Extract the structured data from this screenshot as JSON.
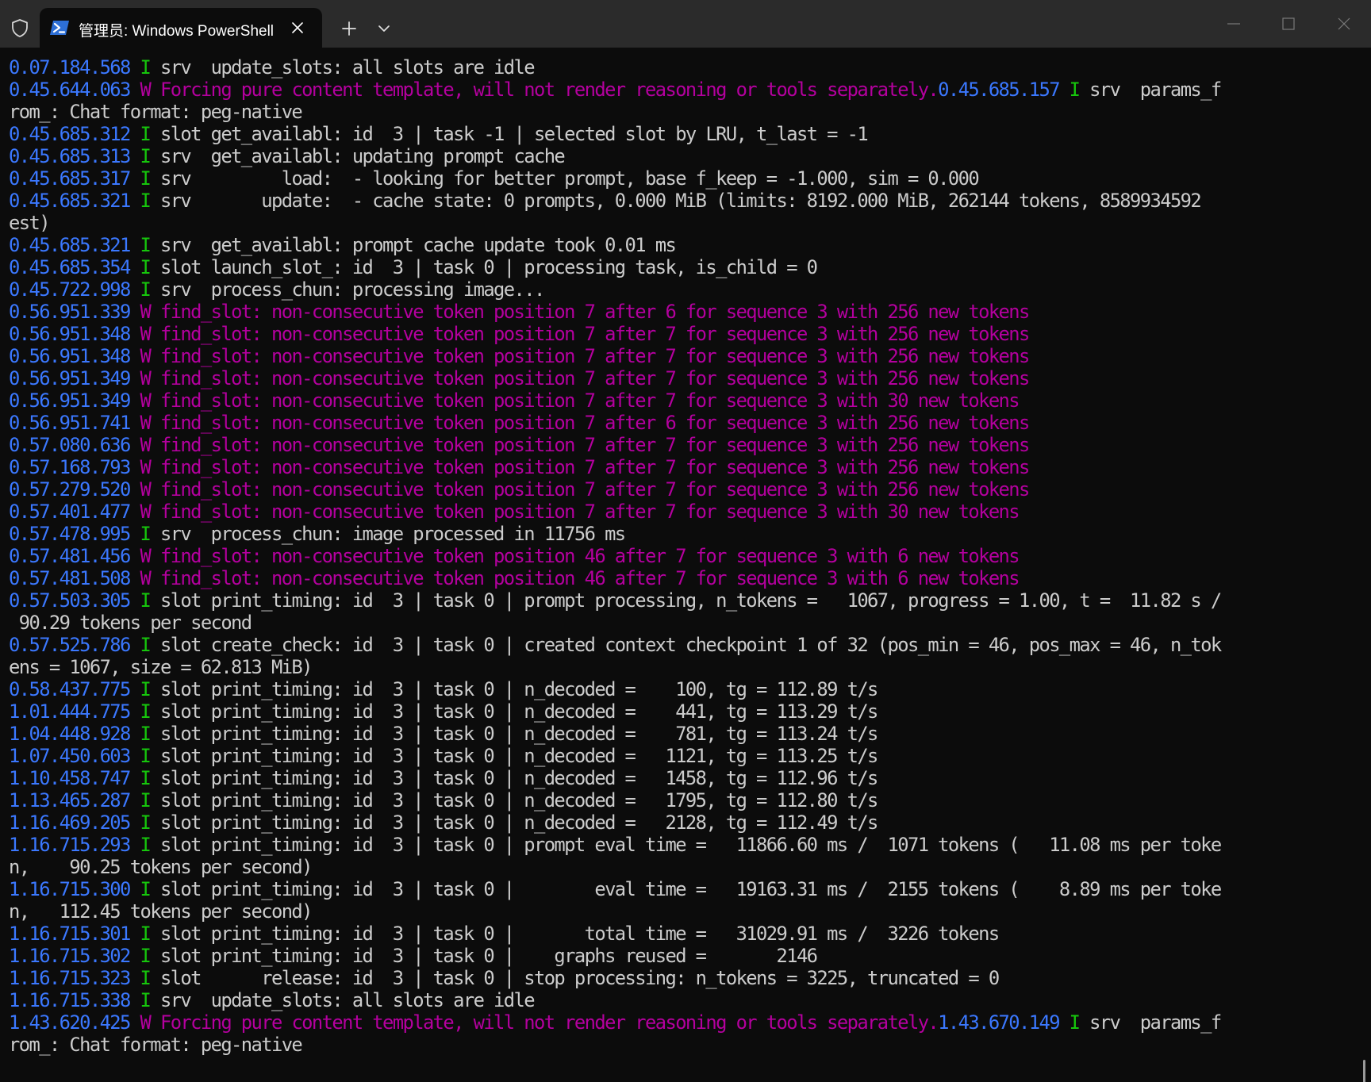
{
  "window": {
    "tab_title": "管理员: Windows PowerShell",
    "icons": {
      "shield": "shield-icon",
      "tab": "powershell-icon",
      "close_tab": "close-icon",
      "new_tab": "plus-icon",
      "dropdown": "chevron-down-icon",
      "minimize": "minimize-icon",
      "maximize": "maximize-icon",
      "close_window": "close-icon"
    }
  },
  "colors": {
    "background": "#0c0c0c",
    "titlebar": "#2b2b2b",
    "timestamp": "#3b78ff",
    "info_level": "#16c60c",
    "warning_level": "#b4009e",
    "text": "#cccccc"
  },
  "terminal": {
    "lines": [
      [
        [
          "ts",
          "0.07.184.568"
        ],
        [
          "t",
          " "
        ],
        [
          "li",
          "I"
        ],
        [
          "t",
          " srv  update_slots: all slots are idle"
        ]
      ],
      [
        [
          "ts",
          "0.45.644.063"
        ],
        [
          "t",
          " "
        ],
        [
          "lw",
          "W"
        ],
        [
          "wm",
          " Forcing pure content template, will not render reasoning or tools separately."
        ],
        [
          "ts",
          "0.45.685.157"
        ],
        [
          "t",
          " "
        ],
        [
          "li",
          "I"
        ],
        [
          "t",
          " srv  params_f"
        ]
      ],
      [
        [
          "t",
          "rom_: Chat format: peg-native"
        ]
      ],
      [
        [
          "ts",
          "0.45.685.312"
        ],
        [
          "t",
          " "
        ],
        [
          "li",
          "I"
        ],
        [
          "t",
          " slot get_availabl: id  3 | task -1 | selected slot by LRU, t_last = -1"
        ]
      ],
      [
        [
          "ts",
          "0.45.685.313"
        ],
        [
          "t",
          " "
        ],
        [
          "li",
          "I"
        ],
        [
          "t",
          " srv  get_availabl: updating prompt cache"
        ]
      ],
      [
        [
          "ts",
          "0.45.685.317"
        ],
        [
          "t",
          " "
        ],
        [
          "li",
          "I"
        ],
        [
          "t",
          " srv         load:  - looking for better prompt, base f_keep = -1.000, sim = 0.000"
        ]
      ],
      [
        [
          "ts",
          "0.45.685.321"
        ],
        [
          "t",
          " "
        ],
        [
          "li",
          "I"
        ],
        [
          "t",
          " srv       update:  - cache state: 0 prompts, 0.000 MiB (limits: 8192.000 MiB, 262144 tokens, 8589934592"
        ]
      ],
      [
        [
          "t",
          "est)"
        ]
      ],
      [
        [
          "ts",
          "0.45.685.321"
        ],
        [
          "t",
          " "
        ],
        [
          "li",
          "I"
        ],
        [
          "t",
          " srv  get_availabl: prompt cache update took 0.01 ms"
        ]
      ],
      [
        [
          "ts",
          "0.45.685.354"
        ],
        [
          "t",
          " "
        ],
        [
          "li",
          "I"
        ],
        [
          "t",
          " slot launch_slot_: id  3 | task 0 | processing task, is_child = 0"
        ]
      ],
      [
        [
          "ts",
          "0.45.722.998"
        ],
        [
          "t",
          " "
        ],
        [
          "li",
          "I"
        ],
        [
          "t",
          " srv  process_chun: processing image..."
        ]
      ],
      [
        [
          "ts",
          "0.56.951.339"
        ],
        [
          "t",
          " "
        ],
        [
          "lw",
          "W"
        ],
        [
          "wm",
          " find_slot: non-consecutive token position 7 after 6 for sequence 3 with 256 new tokens"
        ]
      ],
      [
        [
          "ts",
          "0.56.951.348"
        ],
        [
          "t",
          " "
        ],
        [
          "lw",
          "W"
        ],
        [
          "wm",
          " find_slot: non-consecutive token position 7 after 7 for sequence 3 with 256 new tokens"
        ]
      ],
      [
        [
          "ts",
          "0.56.951.348"
        ],
        [
          "t",
          " "
        ],
        [
          "lw",
          "W"
        ],
        [
          "wm",
          " find_slot: non-consecutive token position 7 after 7 for sequence 3 with 256 new tokens"
        ]
      ],
      [
        [
          "ts",
          "0.56.951.349"
        ],
        [
          "t",
          " "
        ],
        [
          "lw",
          "W"
        ],
        [
          "wm",
          " find_slot: non-consecutive token position 7 after 7 for sequence 3 with 256 new tokens"
        ]
      ],
      [
        [
          "ts",
          "0.56.951.349"
        ],
        [
          "t",
          " "
        ],
        [
          "lw",
          "W"
        ],
        [
          "wm",
          " find_slot: non-consecutive token position 7 after 7 for sequence 3 with 30 new tokens"
        ]
      ],
      [
        [
          "ts",
          "0.56.951.741"
        ],
        [
          "t",
          " "
        ],
        [
          "lw",
          "W"
        ],
        [
          "wm",
          " find_slot: non-consecutive token position 7 after 6 for sequence 3 with 256 new tokens"
        ]
      ],
      [
        [
          "ts",
          "0.57.080.636"
        ],
        [
          "t",
          " "
        ],
        [
          "lw",
          "W"
        ],
        [
          "wm",
          " find_slot: non-consecutive token position 7 after 7 for sequence 3 with 256 new tokens"
        ]
      ],
      [
        [
          "ts",
          "0.57.168.793"
        ],
        [
          "t",
          " "
        ],
        [
          "lw",
          "W"
        ],
        [
          "wm",
          " find_slot: non-consecutive token position 7 after 7 for sequence 3 with 256 new tokens"
        ]
      ],
      [
        [
          "ts",
          "0.57.279.520"
        ],
        [
          "t",
          " "
        ],
        [
          "lw",
          "W"
        ],
        [
          "wm",
          " find_slot: non-consecutive token position 7 after 7 for sequence 3 with 256 new tokens"
        ]
      ],
      [
        [
          "ts",
          "0.57.401.477"
        ],
        [
          "t",
          " "
        ],
        [
          "lw",
          "W"
        ],
        [
          "wm",
          " find_slot: non-consecutive token position 7 after 7 for sequence 3 with 30 new tokens"
        ]
      ],
      [
        [
          "ts",
          "0.57.478.995"
        ],
        [
          "t",
          " "
        ],
        [
          "li",
          "I"
        ],
        [
          "t",
          " srv  process_chun: image processed in 11756 ms"
        ]
      ],
      [
        [
          "ts",
          "0.57.481.456"
        ],
        [
          "t",
          " "
        ],
        [
          "lw",
          "W"
        ],
        [
          "wm",
          " find_slot: non-consecutive token position 46 after 7 for sequence 3 with 6 new tokens"
        ]
      ],
      [
        [
          "ts",
          "0.57.481.508"
        ],
        [
          "t",
          " "
        ],
        [
          "lw",
          "W"
        ],
        [
          "wm",
          " find_slot: non-consecutive token position 46 after 7 for sequence 3 with 6 new tokens"
        ]
      ],
      [
        [
          "ts",
          "0.57.503.305"
        ],
        [
          "t",
          " "
        ],
        [
          "li",
          "I"
        ],
        [
          "t",
          " slot print_timing: id  3 | task 0 | prompt processing, n_tokens =   1067, progress = 1.00, t =  11.82 s /"
        ]
      ],
      [
        [
          "t",
          " 90.29 tokens per second"
        ]
      ],
      [
        [
          "ts",
          "0.57.525.786"
        ],
        [
          "t",
          " "
        ],
        [
          "li",
          "I"
        ],
        [
          "t",
          " slot create_check: id  3 | task 0 | created context checkpoint 1 of 32 (pos_min = 46, pos_max = 46, n_tok"
        ]
      ],
      [
        [
          "t",
          "ens = 1067, size = 62.813 MiB)"
        ]
      ],
      [
        [
          "ts",
          "0.58.437.775"
        ],
        [
          "t",
          " "
        ],
        [
          "li",
          "I"
        ],
        [
          "t",
          " slot print_timing: id  3 | task 0 | n_decoded =    100, tg = 112.89 t/s"
        ]
      ],
      [
        [
          "ts",
          "1.01.444.775"
        ],
        [
          "t",
          " "
        ],
        [
          "li",
          "I"
        ],
        [
          "t",
          " slot print_timing: id  3 | task 0 | n_decoded =    441, tg = 113.29 t/s"
        ]
      ],
      [
        [
          "ts",
          "1.04.448.928"
        ],
        [
          "t",
          " "
        ],
        [
          "li",
          "I"
        ],
        [
          "t",
          " slot print_timing: id  3 | task 0 | n_decoded =    781, tg = 113.24 t/s"
        ]
      ],
      [
        [
          "ts",
          "1.07.450.603"
        ],
        [
          "t",
          " "
        ],
        [
          "li",
          "I"
        ],
        [
          "t",
          " slot print_timing: id  3 | task 0 | n_decoded =   1121, tg = 113.25 t/s"
        ]
      ],
      [
        [
          "ts",
          "1.10.458.747"
        ],
        [
          "t",
          " "
        ],
        [
          "li",
          "I"
        ],
        [
          "t",
          " slot print_timing: id  3 | task 0 | n_decoded =   1458, tg = 112.96 t/s"
        ]
      ],
      [
        [
          "ts",
          "1.13.465.287"
        ],
        [
          "t",
          " "
        ],
        [
          "li",
          "I"
        ],
        [
          "t",
          " slot print_timing: id  3 | task 0 | n_decoded =   1795, tg = 112.80 t/s"
        ]
      ],
      [
        [
          "ts",
          "1.16.469.205"
        ],
        [
          "t",
          " "
        ],
        [
          "li",
          "I"
        ],
        [
          "t",
          " slot print_timing: id  3 | task 0 | n_decoded =   2128, tg = 112.49 t/s"
        ]
      ],
      [
        [
          "ts",
          "1.16.715.293"
        ],
        [
          "t",
          " "
        ],
        [
          "li",
          "I"
        ],
        [
          "t",
          " slot print_timing: id  3 | task 0 | prompt eval time =   11866.60 ms /  1071 tokens (   11.08 ms per toke"
        ]
      ],
      [
        [
          "t",
          "n,    90.25 tokens per second)"
        ]
      ],
      [
        [
          "ts",
          "1.16.715.300"
        ],
        [
          "t",
          " "
        ],
        [
          "li",
          "I"
        ],
        [
          "t",
          " slot print_timing: id  3 | task 0 |        eval time =   19163.31 ms /  2155 tokens (    8.89 ms per toke"
        ]
      ],
      [
        [
          "t",
          "n,   112.45 tokens per second)"
        ]
      ],
      [
        [
          "ts",
          "1.16.715.301"
        ],
        [
          "t",
          " "
        ],
        [
          "li",
          "I"
        ],
        [
          "t",
          " slot print_timing: id  3 | task 0 |       total time =   31029.91 ms /  3226 tokens"
        ]
      ],
      [
        [
          "ts",
          "1.16.715.302"
        ],
        [
          "t",
          " "
        ],
        [
          "li",
          "I"
        ],
        [
          "t",
          " slot print_timing: id  3 | task 0 |    graphs reused =       2146"
        ]
      ],
      [
        [
          "ts",
          "1.16.715.323"
        ],
        [
          "t",
          " "
        ],
        [
          "li",
          "I"
        ],
        [
          "t",
          " slot      release: id  3 | task 0 | stop processing: n_tokens = 3225, truncated = 0"
        ]
      ],
      [
        [
          "ts",
          "1.16.715.338"
        ],
        [
          "t",
          " "
        ],
        [
          "li",
          "I"
        ],
        [
          "t",
          " srv  update_slots: all slots are idle"
        ]
      ],
      [
        [
          "ts",
          "1.43.620.425"
        ],
        [
          "t",
          " "
        ],
        [
          "lw",
          "W"
        ],
        [
          "wm",
          " Forcing pure content template, will not render reasoning or tools separately."
        ],
        [
          "ts",
          "1.43.670.149"
        ],
        [
          "t",
          " "
        ],
        [
          "li",
          "I"
        ],
        [
          "t",
          " srv  params_f"
        ]
      ],
      [
        [
          "t",
          "rom_: Chat format: peg-native"
        ]
      ]
    ]
  }
}
